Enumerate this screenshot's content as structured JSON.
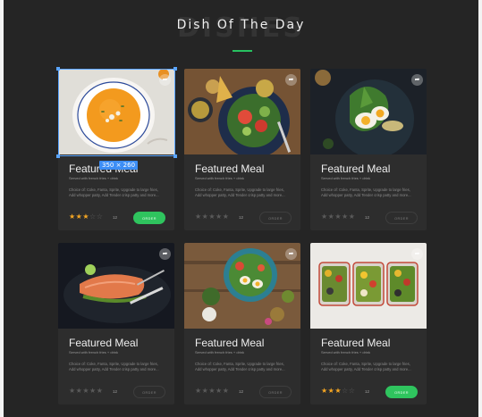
{
  "header": {
    "background_word": "DISHES",
    "title": "Dish Of The Day",
    "accent_color": "#27c160"
  },
  "selection": {
    "size_label": "350 × 260"
  },
  "cards": [
    {
      "title": "Featured Meal",
      "subtitle": "Served with french fries + drink",
      "description": "Choice of: Coke, Fanta, Sprite, Upgrade to large fries, Add whopper patty, Add Tender crisp patty and more...",
      "rating_stars": "★★★",
      "empty_stars": "☆☆",
      "rating_count": "12",
      "button_label": "ORDER",
      "button_active": true,
      "image_icon": "pumpkin-soup-image"
    },
    {
      "title": "Featured Meal",
      "subtitle": "Served with french fries + drink",
      "description": "Choice of: Coke, Fanta, Sprite, Upgrade to large fries, Add whopper patty, Add Tender crisp patty and more...",
      "rating_stars": "",
      "empty_stars": "★★★★★",
      "rating_count": "12",
      "button_label": "ORDER",
      "button_active": false,
      "image_icon": "salad-bowl-image"
    },
    {
      "title": "Featured Meal",
      "subtitle": "Served with french fries + drink",
      "description": "Choice of: Coke, Fanta, Sprite, Upgrade to large fries, Add whopper patty, Add Tender crisp patty and more...",
      "rating_stars": "",
      "empty_stars": "★★★★★",
      "rating_count": "12",
      "button_label": "ORDER",
      "button_active": false,
      "image_icon": "egg-avocado-image"
    },
    {
      "title": "Featured Meal",
      "subtitle": "Served with french fries + drink",
      "description": "Choice of: Coke, Fanta, Sprite, Upgrade to large fries, Add whopper patty, Add Tender crisp patty and more...",
      "rating_stars": "",
      "empty_stars": "★★★★★",
      "rating_count": "12",
      "button_label": "ORDER",
      "button_active": false,
      "image_icon": "salmon-plate-image"
    },
    {
      "title": "Featured Meal",
      "subtitle": "Served with french fries + drink",
      "description": "Choice of: Coke, Fanta, Sprite, Upgrade to large fries, Add whopper patty, Add Tender crisp patty and more...",
      "rating_stars": "",
      "empty_stars": "★★★★★",
      "rating_count": "12",
      "button_label": "ORDER",
      "button_active": false,
      "image_icon": "egg-salad-bowl-image"
    },
    {
      "title": "Featured Meal",
      "subtitle": "Served with french fries + drink",
      "description": "Choice of: Coke, Fanta, Sprite, Upgrade to large fries, Add whopper patty, Add Tender crisp patty and more...",
      "rating_stars": "★★★",
      "empty_stars": "☆☆",
      "rating_count": "12",
      "button_label": "ORDER",
      "button_active": true,
      "image_icon": "meal-prep-containers-image"
    }
  ]
}
